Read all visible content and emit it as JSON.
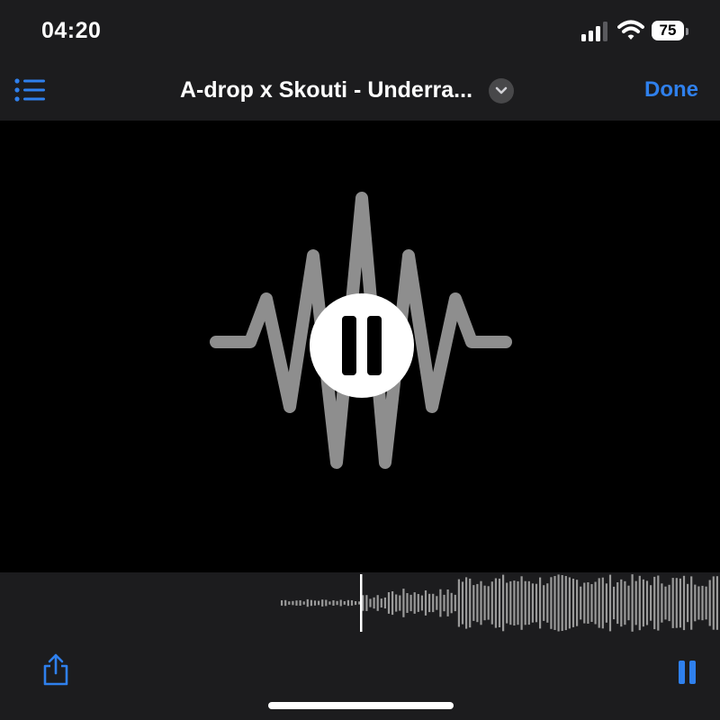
{
  "status_bar": {
    "time": "04:20",
    "battery_percent": "75",
    "signal_bars": 3,
    "icons": [
      "signal-icon",
      "wifi-icon",
      "battery-icon"
    ]
  },
  "nav": {
    "menu_icon": "list-icon",
    "title": "A-drop x Skouti - Underra...",
    "title_menu_icon": "chevron-down-icon",
    "done_label": "Done"
  },
  "player": {
    "state": "playing",
    "center_control_icon": "pause-icon",
    "artwork_icon": "sound-wave-icon"
  },
  "scrubber": {
    "progress_fraction": 0.29
  },
  "toolbar": {
    "share_icon": "share-icon",
    "pause_icon": "pause-icon"
  },
  "colors": {
    "accent": "#2f80ed",
    "background": "#1c1c1e",
    "artwork_background": "#000000",
    "waveform_mark": "#9a9a9a"
  }
}
